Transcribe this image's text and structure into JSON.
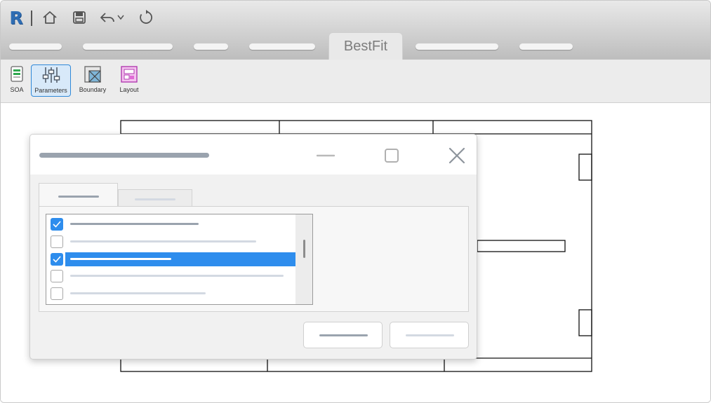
{
  "app": {
    "logo_letter": "R"
  },
  "quick_access": [
    {
      "name": "home-icon"
    },
    {
      "name": "save-icon"
    },
    {
      "name": "undo-icon"
    },
    {
      "name": "dropdown-arrow-icon"
    },
    {
      "name": "refresh-icon"
    }
  ],
  "ribbon_tabs": {
    "active_label": "BestFit"
  },
  "ribbon_buttons": [
    {
      "id": "soa",
      "label": "SOA",
      "icon": "document-icon"
    },
    {
      "id": "parameters",
      "label": "Parameters",
      "icon": "sliders-icon",
      "active": true
    },
    {
      "id": "boundary",
      "label": "Boundary",
      "icon": "boundary-icon"
    },
    {
      "id": "layout",
      "label": "Layout",
      "icon": "layout-icon"
    }
  ],
  "dialog": {
    "controls": [
      "minimize-icon",
      "maximize-icon",
      "close-icon"
    ],
    "list_items": [
      {
        "checked": true,
        "selected": false
      },
      {
        "checked": false,
        "selected": false
      },
      {
        "checked": true,
        "selected": true
      },
      {
        "checked": false,
        "selected": false
      },
      {
        "checked": false,
        "selected": false
      }
    ]
  },
  "colors": {
    "accent": "#2e8ded",
    "logo": "#2e6db4",
    "placeholder_dark": "#9aa3ae",
    "placeholder_light": "#d3d9e2"
  }
}
